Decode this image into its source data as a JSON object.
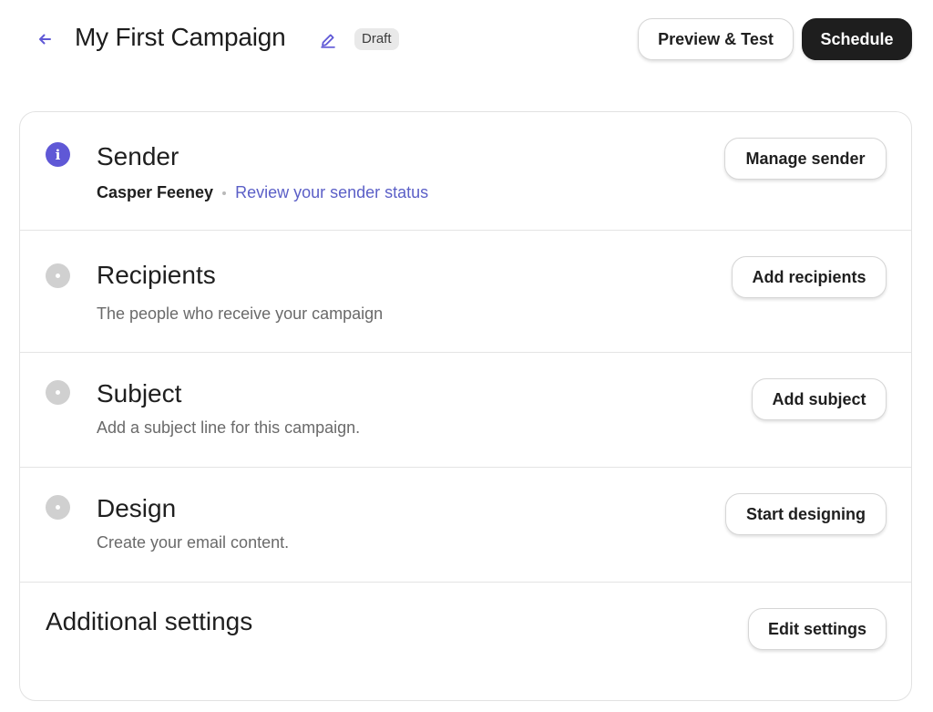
{
  "header": {
    "back_icon": "arrow-left-icon",
    "title": "My First Campaign",
    "edit_icon": "pencil-icon",
    "badge": "Draft",
    "preview_label": "Preview & Test",
    "schedule_label": "Schedule"
  },
  "colors": {
    "accent": "#5f58d6",
    "link": "#5b5fc7",
    "primary_button": "#1e1e1e",
    "pending_status": "#d0d0d0"
  },
  "sections": {
    "sender": {
      "status": "info",
      "status_icon": "info-icon",
      "title": "Sender",
      "name": "Casper Feeney",
      "link": "Review your sender status",
      "button": "Manage sender"
    },
    "recipients": {
      "status": "pending",
      "status_icon": "pending-circle-icon",
      "title": "Recipients",
      "description": "The people who receive your campaign",
      "button": "Add recipients"
    },
    "subject": {
      "status": "pending",
      "status_icon": "pending-circle-icon",
      "title": "Subject",
      "description": "Add a subject line for this campaign.",
      "button": "Add subject"
    },
    "design": {
      "status": "pending",
      "status_icon": "pending-circle-icon",
      "title": "Design",
      "description": "Create your email content.",
      "button": "Start designing"
    },
    "additional": {
      "title": "Additional settings",
      "button": "Edit settings"
    }
  }
}
